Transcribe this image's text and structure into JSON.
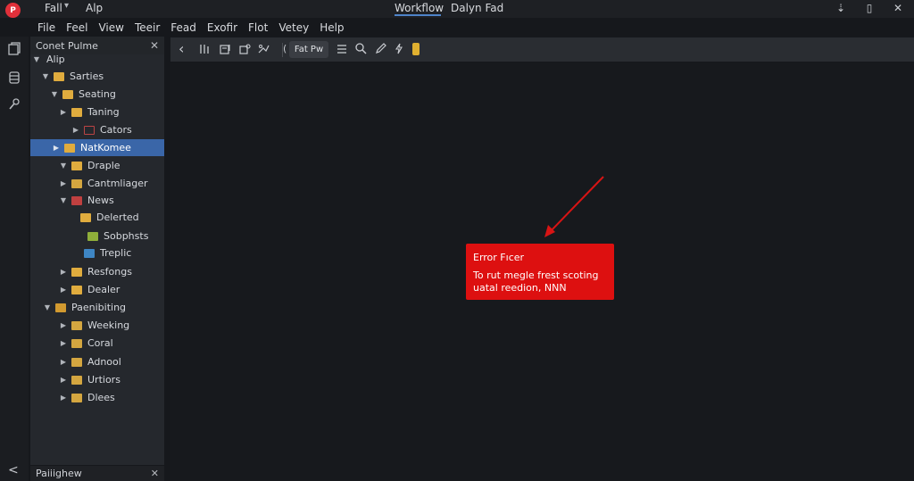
{
  "titlebar": {
    "menu_label": "Fall",
    "menu_chevron": "▾",
    "app_label": "Alp",
    "tab_workflow": "Workflow",
    "document_title": "Dalyn Fad",
    "logo_text": "P",
    "minimize": "⇣",
    "maximize": "▯",
    "close": "✕"
  },
  "menubar": {
    "items": [
      "File",
      "Feel",
      "View",
      "Teeir",
      "Fead",
      "Exofir",
      "Flot",
      "Vetey",
      "Help"
    ]
  },
  "activity": {
    "icons": [
      "explorer-icon",
      "database-icon",
      "tools-icon"
    ],
    "collapse": "<"
  },
  "sidebar": {
    "title": "Conet Pulme",
    "close": "✕",
    "items": [
      {
        "label": "Alip",
        "twisty": "▼"
      },
      {
        "label": "Sarties",
        "twisty": "▼"
      },
      {
        "label": "Seating",
        "twisty": "▼"
      },
      {
        "label": "Taning",
        "twisty": "▶"
      },
      {
        "label": "Cators",
        "twisty": "▶"
      },
      {
        "label": "NatKomee",
        "twisty": "▶"
      },
      {
        "label": "Draple",
        "twisty": "▼"
      },
      {
        "label": "Cantmliager",
        "twisty": "▶"
      },
      {
        "label": "News",
        "twisty": "▼"
      },
      {
        "label": "Delerted",
        "twisty": ""
      },
      {
        "label": "Sobphsts",
        "twisty": ""
      },
      {
        "label": "Treplic",
        "twisty": ""
      },
      {
        "label": "Resfongs",
        "twisty": "▶"
      },
      {
        "label": "Dealer",
        "twisty": "▶"
      },
      {
        "label": "Paenibiting",
        "twisty": "▼"
      },
      {
        "label": "Weeking",
        "twisty": "▶"
      },
      {
        "label": "Coral",
        "twisty": "▶"
      },
      {
        "label": "Adnool",
        "twisty": "▶"
      },
      {
        "label": "Urtiors",
        "twisty": "▶"
      },
      {
        "label": "Dlees",
        "twisty": "▶"
      }
    ]
  },
  "bottom_panel": {
    "title": "Paiiighew",
    "close": "✕"
  },
  "toolbar": {
    "back": "‹",
    "combo_label": "Fat Pw",
    "paren": "("
  },
  "error": {
    "title": "Error Fıcer",
    "message": "To rut megle frest scoting uatal reedion, NNN"
  },
  "colors": {
    "accent": "#3a66a8",
    "error": "#dd1010",
    "folder": "#e0ac3e",
    "logo": "#e0303a"
  }
}
